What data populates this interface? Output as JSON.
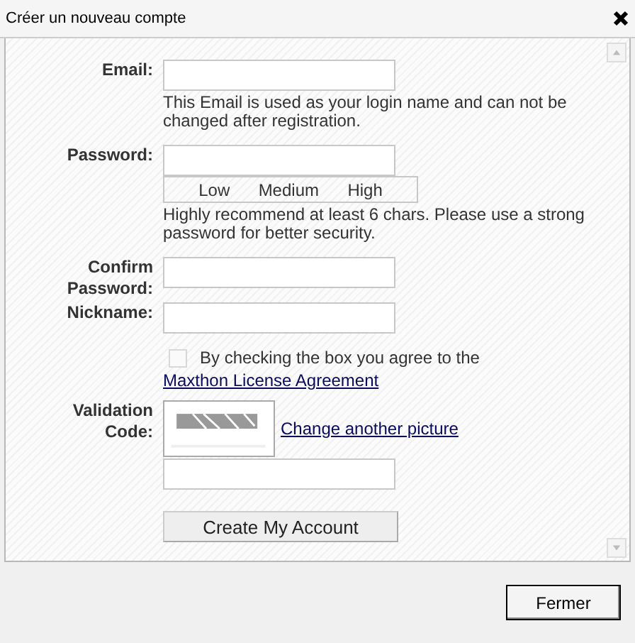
{
  "window": {
    "title": "Créer un nouveau compte"
  },
  "fields": [
    {
      "label": "Email:",
      "hint": "This Email is used as your login name and can not be changed after registration."
    },
    {
      "label": "Password:",
      "strength": [
        "Low",
        "Medium",
        "High"
      ],
      "hint": "Highly recommend at least 6 chars. Please use a strong password for better security."
    },
    {
      "label": "Confirm Password:"
    },
    {
      "label": "Nickname:"
    }
  ],
  "agreement": {
    "checked": false,
    "text": "By checking the box you agree to the",
    "link": "Maxthon License Agreement"
  },
  "validation": {
    "label": "Validation Code:",
    "link": "Change another picture"
  },
  "submit": "Create My Account",
  "footer_button": "Fermer"
}
